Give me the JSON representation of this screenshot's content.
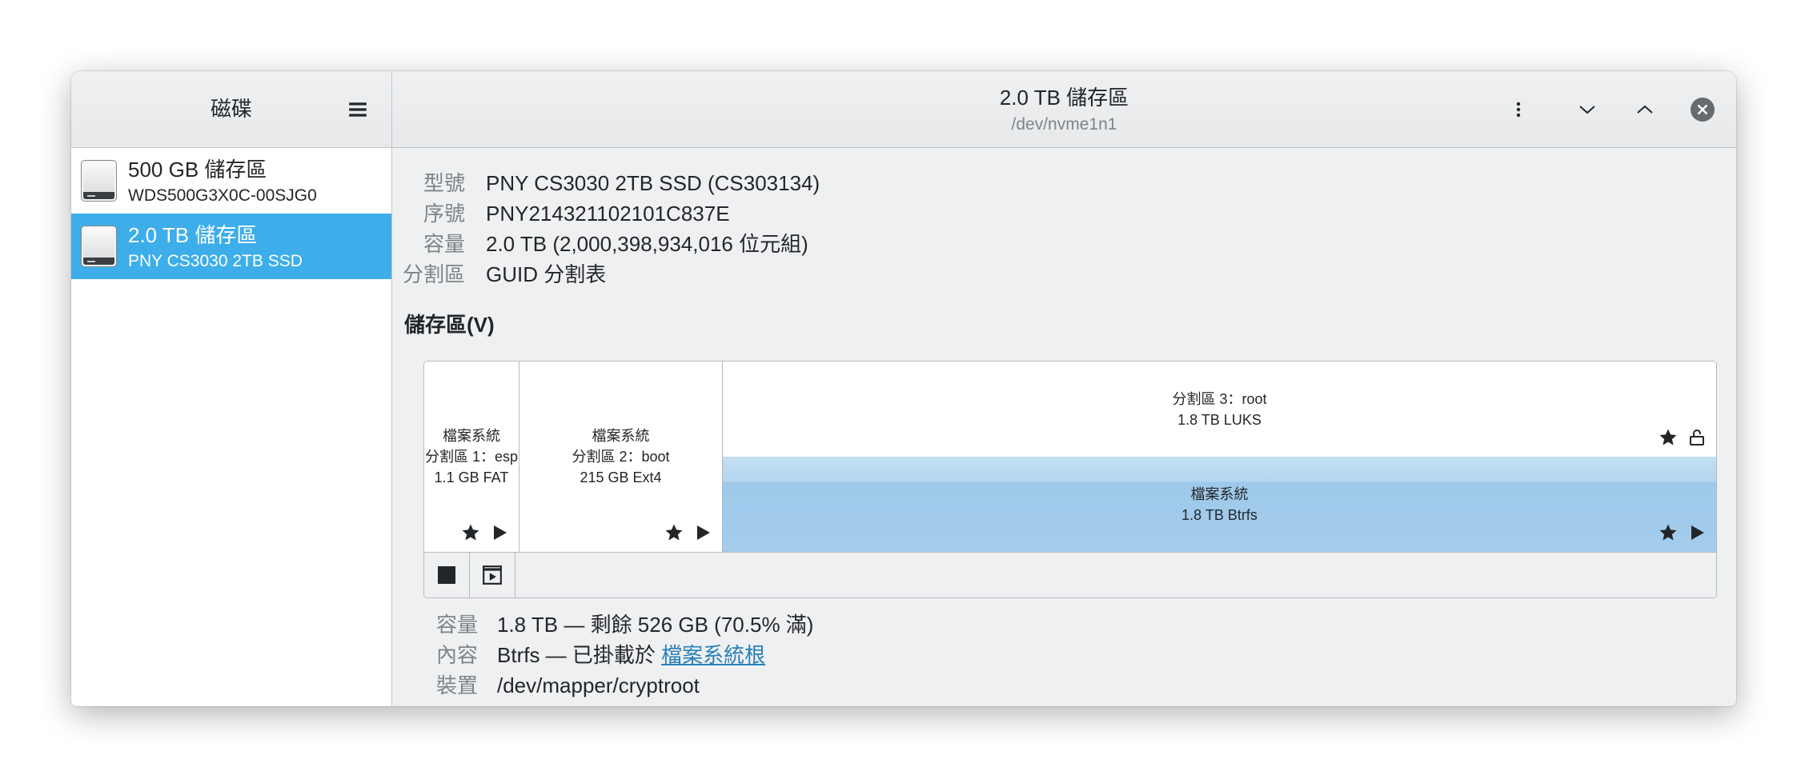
{
  "window": {
    "sidebar_title": "磁碟",
    "title": "2.0 TB 儲存區",
    "subtitle": "/dev/nvme1n1",
    "icons": {
      "sidebar_menu": "hamburger-menu-icon",
      "main_menu": "kebab-menu-icon",
      "minimize": "chevron-down-icon",
      "maximize": "chevron-up-icon",
      "close": "close-icon"
    }
  },
  "sidebar": {
    "items": [
      {
        "title": "500 GB 儲存區",
        "subtitle": "WDS500G3X0C-00SJG0",
        "icon": "drive-harddisk-icon",
        "selected": false
      },
      {
        "title": "2.0 TB 儲存區",
        "subtitle": "PNY CS3030 2TB SSD",
        "icon": "drive-harddisk-icon",
        "selected": true
      }
    ]
  },
  "drive": {
    "fields": [
      {
        "label": "型號",
        "value": "PNY CS3030 2TB SSD (CS303134)"
      },
      {
        "label": "序號",
        "value": "PNY214321102101C837E"
      },
      {
        "label": "容量",
        "value": "2.0 TB (2,000,398,934,016 位元組)"
      },
      {
        "label": "分割區",
        "value": "GUID 分割表"
      }
    ]
  },
  "volumes": {
    "heading": "儲存區(V)",
    "partitions": [
      {
        "lines": [
          "檔案系統",
          "分割區 1：esp",
          "1.1 GB FAT"
        ],
        "icons": [
          "star-icon",
          "play-icon"
        ],
        "selected": false
      },
      {
        "lines": [
          "檔案系統",
          "分割區 2：boot",
          "215 GB Ext4"
        ],
        "icons": [
          "star-icon",
          "play-icon"
        ],
        "selected": false
      },
      {
        "lines": [
          "分割區 3：root",
          "1.8 TB LUKS"
        ],
        "icons": [
          "star-icon",
          "lock-open-icon"
        ],
        "selected": false,
        "contents": {
          "lines": [
            "檔案系統",
            "1.8 TB Btrfs"
          ],
          "icons": [
            "star-icon",
            "play-icon"
          ],
          "selected": true
        }
      }
    ],
    "toolbar_icons": [
      "stop-icon",
      "partition-options-icon"
    ]
  },
  "selected_volume": {
    "fields": [
      {
        "label": "容量",
        "value": "1.8 TB — 剩餘 526 GB (70.5% 滿)"
      },
      {
        "label": "內容",
        "value": "Btrfs — 已掛載於 ",
        "link": "檔案系統根"
      },
      {
        "label": "裝置",
        "value": "/dev/mapper/cryptroot"
      }
    ]
  },
  "colors": {
    "accent": "#3daee9",
    "link": "#2980b9",
    "selected_partition": "#9fc9ea",
    "window_bg": "#eff0f1"
  }
}
